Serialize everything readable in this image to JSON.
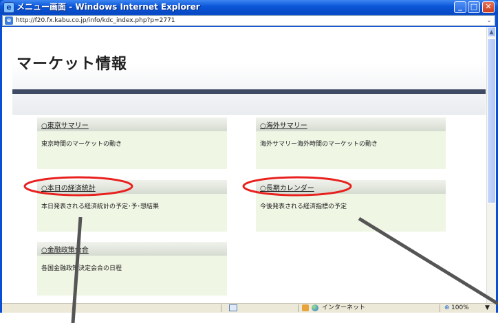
{
  "window": {
    "title": "メニュー画面 - Windows Internet Explorer",
    "url": "http://f20.fx.kabu.co.jp/info/kdc_index.php?p=2771",
    "buttons": {
      "minimize": "_",
      "maximize": "□",
      "close": "✕"
    }
  },
  "page": {
    "title": "マーケット情報",
    "panels": [
      {
        "link": "○東京サマリー",
        "desc": "東京時間のマーケットの動き"
      },
      {
        "link": "○海外サマリー",
        "desc": "海外サマリー海外時間のマーケットの動き"
      },
      {
        "link": "○本日の経済統計",
        "desc": "本日発表される経済統計の予定･予･想結果"
      },
      {
        "link": "○長期カレンダー",
        "desc": "今後発表される経済指標の予定"
      },
      {
        "link": "○金融政策会合",
        "desc": "各国金融政策決定会合の日程"
      }
    ]
  },
  "statusbar": {
    "zone": "インターネット",
    "zoom": "100%",
    "zoom_drop": "▼"
  },
  "icons": {
    "title": "ie-icon",
    "address": "page-icon",
    "zone": "globe-icon",
    "zoom": "magnifier-icon"
  },
  "colors": {
    "titlebar": "#0a55d8",
    "panel_bg": "#eff6e4",
    "header_rule": "#3f4a63",
    "highlight": "#e8201e",
    "pointer": "#555555"
  }
}
